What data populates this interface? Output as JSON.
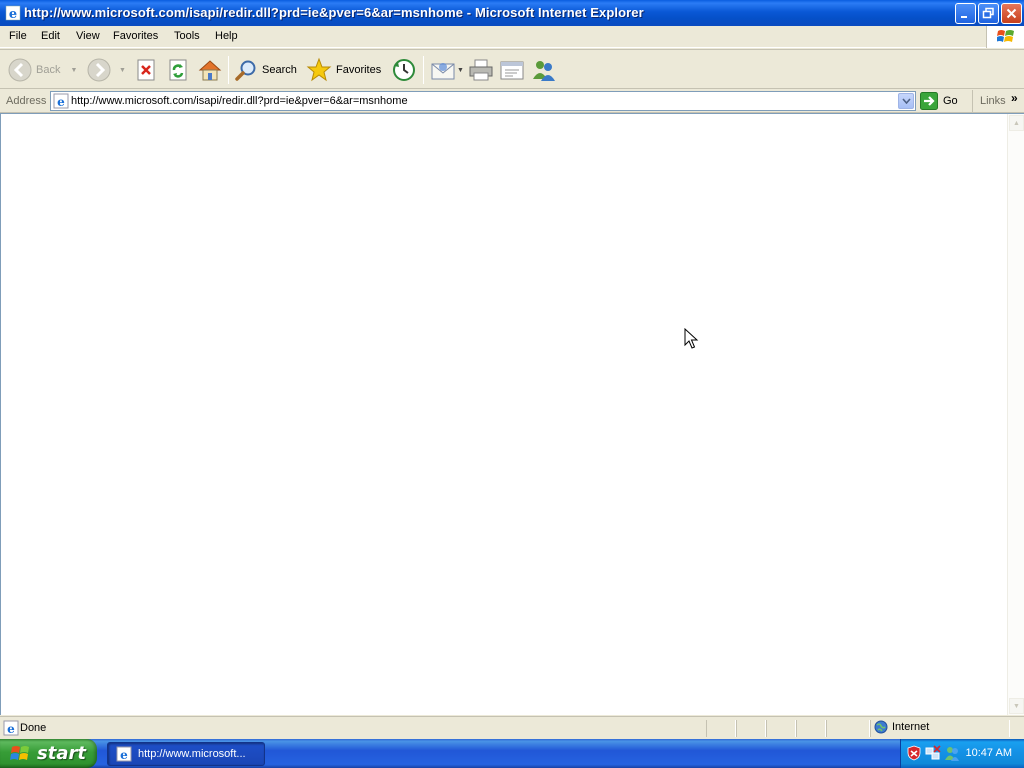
{
  "window": {
    "title": "http://www.microsoft.com/isapi/redir.dll?prd=ie&pver=6&ar=msnhome - Microsoft Internet Explorer",
    "icon": "ie-icon"
  },
  "menu": [
    "File",
    "Edit",
    "View",
    "Favorites",
    "Tools",
    "Help"
  ],
  "toolbar": {
    "back_label": "Back",
    "search_label": "Search",
    "favorites_label": "Favorites"
  },
  "address": {
    "label": "Address",
    "url": "http://www.microsoft.com/isapi/redir.dll?prd=ie&pver=6&ar=msnhome",
    "go_label": "Go",
    "links_label": "Links",
    "links_chevron": "»"
  },
  "status": {
    "text": "Done",
    "zone": "Internet"
  },
  "taskbar": {
    "start_label": "start",
    "task_label": "http://www.microsoft...",
    "clock": "10:47 AM"
  },
  "colors": {
    "titlebar": "#0a58d6",
    "taskbar": "#2157d7",
    "start": "#379d37",
    "tray": "#1491e6",
    "chrome": "#ece9d8"
  }
}
